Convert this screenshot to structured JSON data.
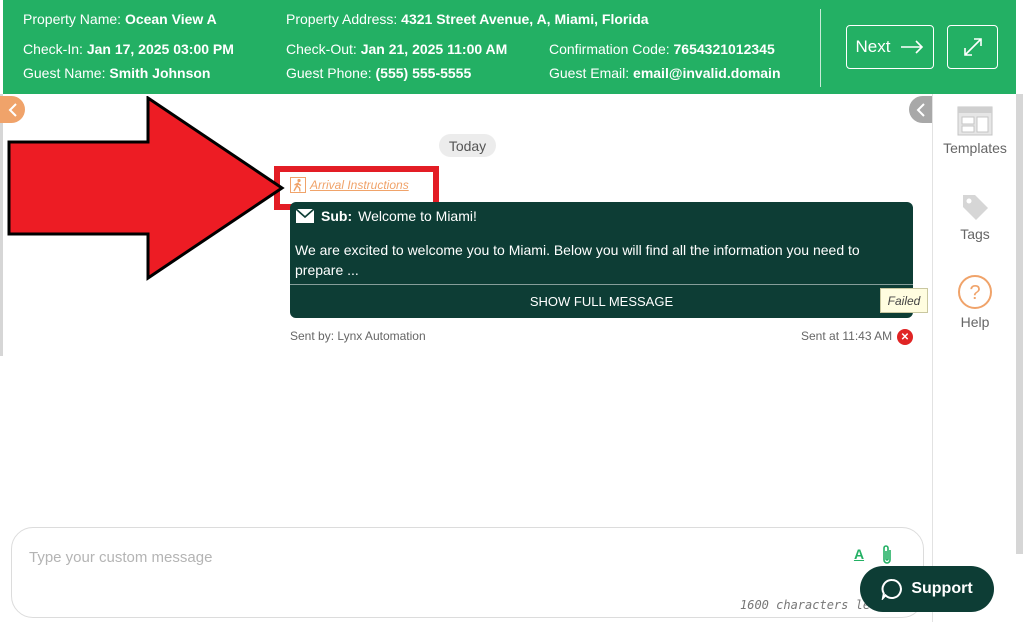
{
  "header": {
    "property_name_label": "Property Name:",
    "property_name": "Ocean View A",
    "property_address_label": "Property Address:",
    "property_address": "4321 Street Avenue, A, Miami, Florida",
    "checkin_label": "Check-In:",
    "checkin": "Jan 17, 2025 03:00 PM",
    "checkout_label": "Check-Out:",
    "checkout": "Jan 21, 2025 11:00 AM",
    "confirmation_label": "Confirmation Code:",
    "confirmation": "7654321012345",
    "guest_name_label": "Guest Name:",
    "guest_name": "Smith Johnson",
    "guest_phone_label": "Guest Phone:",
    "guest_phone": "(555) 555-5555",
    "guest_email_label": "Guest Email:",
    "guest_email": "email@invalid.domain",
    "next_label": "Next"
  },
  "sidebar": {
    "templates_label": "Templates",
    "tags_label": "Tags",
    "help_label": "Help"
  },
  "chat": {
    "date_divider": "Today",
    "template_link": "Arrival Instructions",
    "message": {
      "sub_label": "Sub:",
      "subject": "Welcome to Miami!",
      "body": "We are excited to welcome you to Miami. Below you will find all the information you need to prepare ...",
      "show_full": "SHOW FULL MESSAGE",
      "status": "Failed",
      "sent_by": "Sent by: Lynx Automation",
      "sent_at": "Sent at 11:43 AM"
    }
  },
  "composer": {
    "placeholder": "Type your custom message",
    "font_label": "A",
    "char_count": "1600 characters left."
  },
  "support": {
    "label": "Support"
  },
  "colors": {
    "header_green": "#23b064",
    "message_dark": "#0d3d35",
    "annotation_red": "#e31d25",
    "link_orange": "#f0a36a"
  }
}
